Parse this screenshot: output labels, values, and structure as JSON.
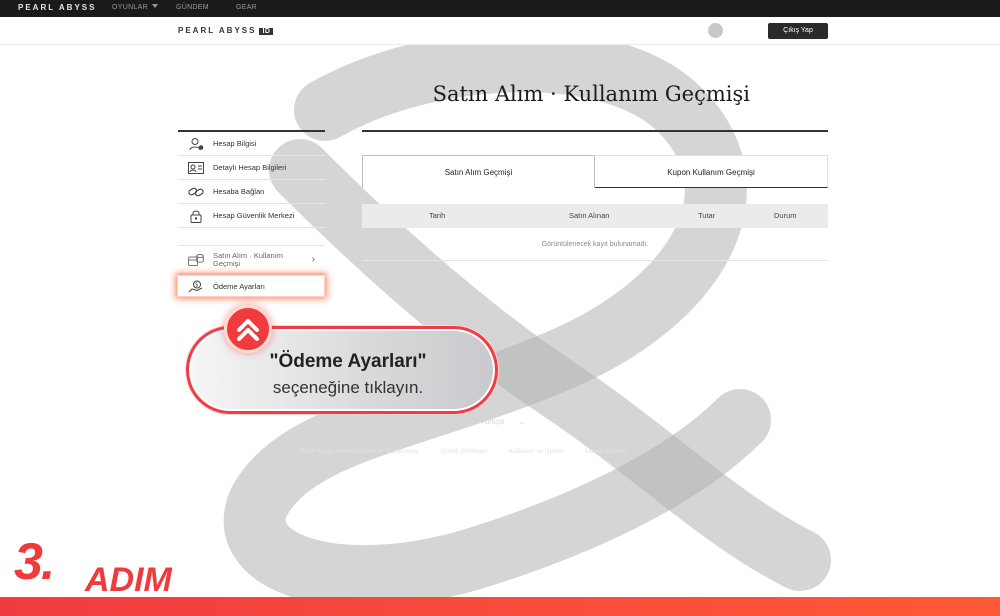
{
  "topnav": {
    "brand": "PEARL ABYSS",
    "items": [
      "OYUNLAR",
      "GÜNDEM",
      "GEAR"
    ]
  },
  "header": {
    "logo": "PEARL ABYSS",
    "logo_badge": "ID",
    "logout_label": "Çıkış Yap"
  },
  "page": {
    "title": "Satın Alım · Kullanım Geçmişi"
  },
  "sidebar": {
    "items": [
      {
        "label": "Hesap Bilgisi",
        "icon": "user-icon"
      },
      {
        "label": "Detaylı Hesap Bilgileri",
        "icon": "id-card-icon"
      },
      {
        "label": "Hesaba Bağlan",
        "icon": "link-icon"
      },
      {
        "label": "Hesap Güvenlik Merkezi",
        "icon": "lock-icon"
      },
      {
        "label": "Satın Alım · Kullanım Geçmişi",
        "icon": "coins-icon"
      },
      {
        "label": "Ödeme Ayarları",
        "icon": "payment-icon"
      }
    ]
  },
  "tabs": {
    "purchase": "Satın Alım Geçmişi",
    "coupon": "Kupon Kullanım Geçmişi"
  },
  "table": {
    "columns": [
      "Tarih",
      "Satın Alınan",
      "Tutar",
      "Durum"
    ],
    "empty": "Görüntülenecek kayıt bulunamadı."
  },
  "footer": {
    "language": "Türkçe",
    "links": [
      "Pearl Abyss Hizmet Kullanım Sözleşmesi",
      "Gizlilik Politikası",
      "Kullanım ve İşletim",
      "Ücretli Destek"
    ]
  },
  "callout": {
    "line1": "\"Ödeme Ayarları\"",
    "line2": "seçeneğine tıklayın."
  },
  "step": {
    "number": "3.",
    "word": "ADIM"
  },
  "colors": {
    "accent": "#ef3b3e",
    "dark": "#1a1a1a"
  }
}
